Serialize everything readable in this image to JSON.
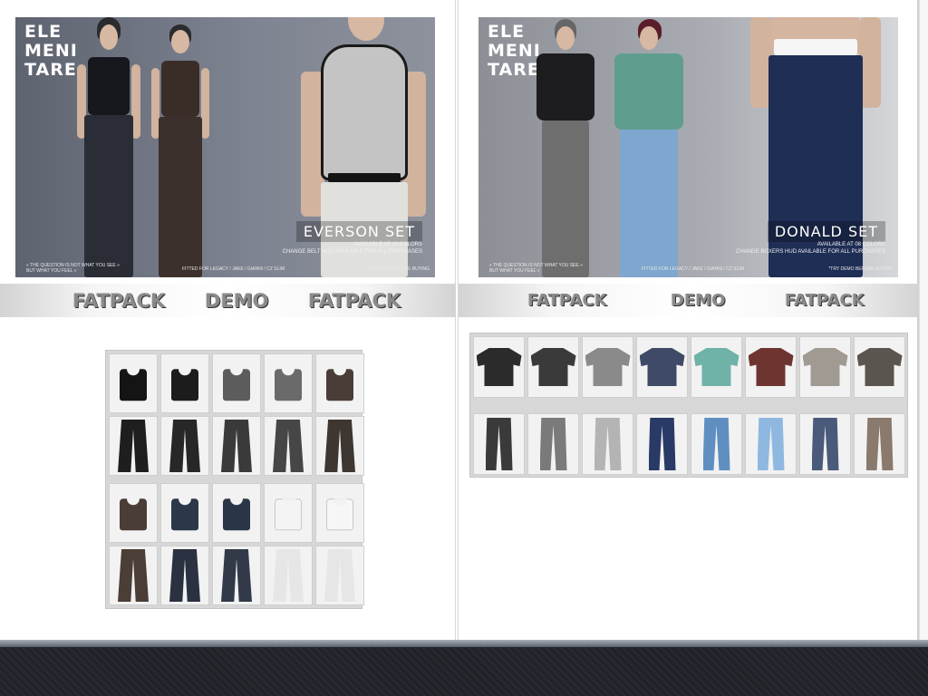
{
  "left": {
    "ad": {
      "logo_lines": [
        "ELE",
        "MENI",
        "TARE"
      ],
      "set_name": "EVERSON SET",
      "sub1": "AVAILABLE AT 10 COLORS",
      "sub2": "CHANGE BELT HUD AVAILABLE FOR ALL PURCHASES",
      "tagline": "« THE QUESTION IS NOT WHAT YOU SEE » BUT WHAT YOU FEEL »",
      "fitted": "FITTED FOR LEGACY / JAKE / GIANNI / CZ SLIM",
      "demo_note": "*TRY DEMO BEFORE BUYING"
    },
    "banner": {
      "fatpack1": "FATPACK",
      "demo": "DEMO",
      "fatpack2": "FATPACK"
    },
    "tops": [
      "#141414",
      "#1c1c1c",
      "#5c5c5c",
      "#6a6a6a",
      "#4a3c36",
      "#4a3c36",
      "#2c3749",
      "#2a3648",
      "#f4f4f4",
      "#f6f6f6"
    ],
    "pants": [
      "#1e1e1e",
      "#272727",
      "#3a3a3a",
      "#464646",
      "#3e3630",
      "#4a3e36",
      "#2a3140",
      "#323a4a",
      "#f4f4f4",
      "#f6f6f6"
    ]
  },
  "right": {
    "ad": {
      "logo_lines": [
        "ELE",
        "MENI",
        "TARE"
      ],
      "set_name": "DONALD SET",
      "sub1": "AVAILABLE AT 08 COLORS",
      "sub2": "CHANGE BOXERS HUD AVAILABLE FOR ALL PURCHASES",
      "tagline": "« THE QUESTION IS NOT WHAT YOU SEE » BUT WHAT YOU FEEL »",
      "fitted": "FITTED FOR LEGACY / JAKE / GIANNI / CZ SLIM",
      "demo_note": "*TRY DEMO BEFORE BUYING"
    },
    "banner": {
      "fatpack1": "FATPACK",
      "demo": "DEMO",
      "fatpack2": "FATPACK"
    },
    "shirts": [
      "#2b2b2b",
      "#3a3a3a",
      "#8a8a8a",
      "#3f4a66",
      "#6fb3a8",
      "#6e3530",
      "#a09a92",
      "#5b5550"
    ],
    "trousers": [
      "#3a3a3a",
      "#7a7a7a",
      "#b4b4b4",
      "#2a3a66",
      "#5f8fc0",
      "#8fb8e0",
      "#4a5a7a",
      "#8a7a6e"
    ]
  }
}
